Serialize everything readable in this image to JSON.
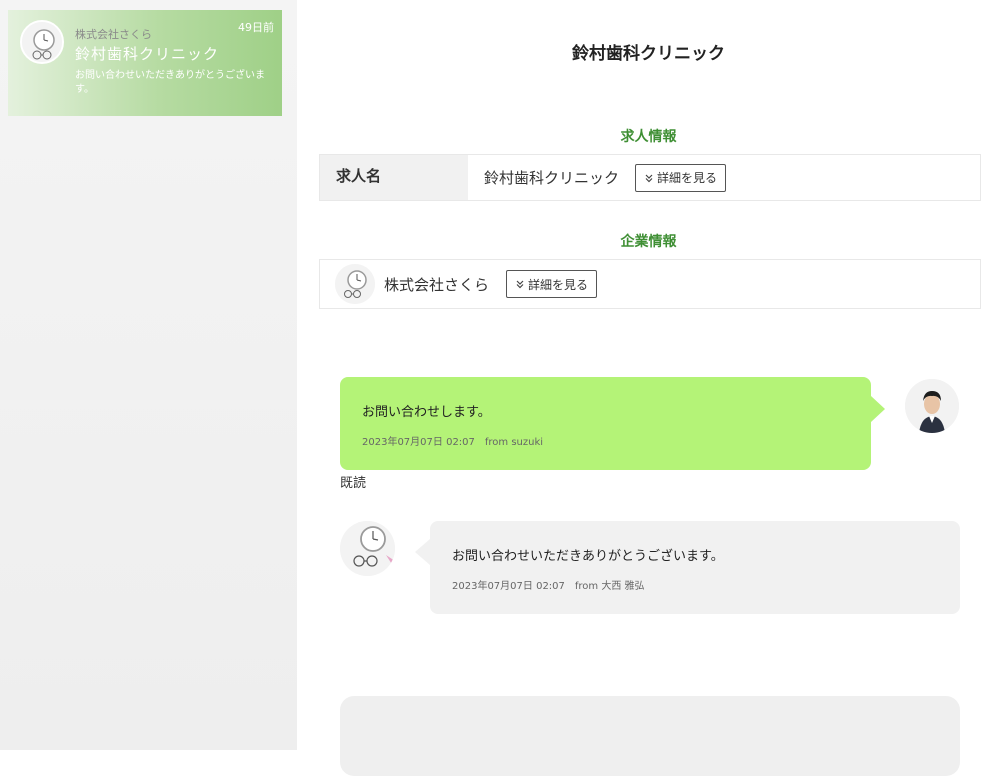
{
  "sidebar": {
    "threads": [
      {
        "company": "株式会社さくら",
        "days_ago": "49日前",
        "title": "鈴村歯科クリニック",
        "preview": "お問い合わせいただきありがとうございます。"
      }
    ]
  },
  "main": {
    "title": "鈴村歯科クリニック",
    "job_section": {
      "heading": "求人情報",
      "label": "求人名",
      "value": "鈴村歯科クリニック",
      "detail_button": "詳細を見る"
    },
    "company_section": {
      "heading": "企業情報",
      "name": "株式会社さくら",
      "detail_button": "詳細を見る"
    },
    "messages": [
      {
        "direction": "outgoing",
        "text": "お問い合わせします。",
        "meta": "2023年07月07日 02:07　from suzuki",
        "read_status": "既読"
      },
      {
        "direction": "incoming",
        "text": "お問い合わせいただきありがとうございます。",
        "meta": "2023年07月07日 02:07　from 大西 雅弘"
      }
    ]
  },
  "colors": {
    "accent_green": "#3f8f34",
    "outgoing_bubble": "#b4f377",
    "incoming_bubble": "#f1f1f1",
    "sidebar_active_gradient_end": "#9fd087"
  },
  "icons": {
    "company_avatar": "clock-and-glasses-avatar",
    "user_avatar": "person-avatar",
    "detail_chevron": "double-chevron-down-icon"
  }
}
